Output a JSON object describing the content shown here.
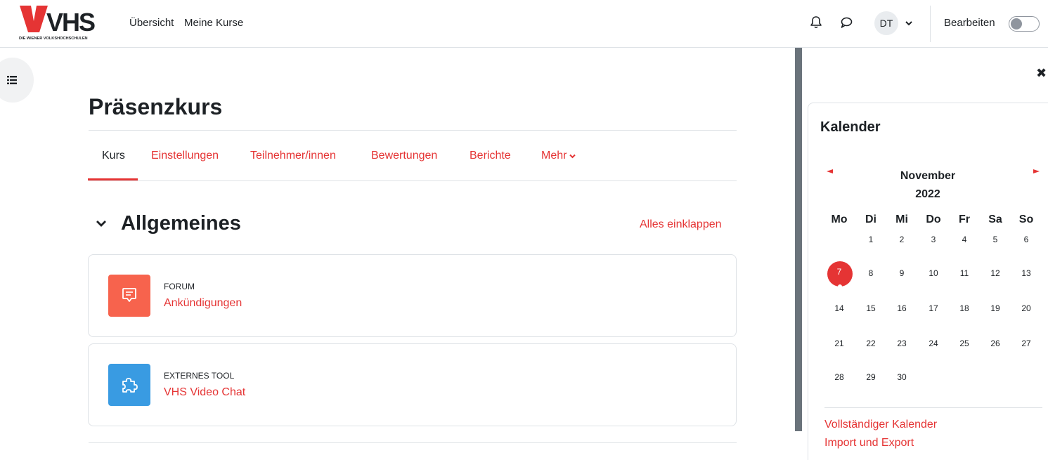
{
  "header": {
    "logo_text": "VHS",
    "logo_subtext": "DIE WIENER VOLKSHOCHSCHULEN",
    "nav": [
      "Übersicht",
      "Meine Kurse"
    ],
    "user_initials": "DT",
    "edit_mode_label": "Bearbeiten",
    "edit_mode_on": false,
    "icons": [
      "bell-icon",
      "chat-icon",
      "chevron-down-icon"
    ]
  },
  "course": {
    "title": "Präsenzkurs",
    "tabs": [
      "Kurs",
      "Einstellungen",
      "Teilnehmer/innen",
      "Bewertungen",
      "Berichte",
      "Mehr"
    ],
    "active_tab": "Kurs"
  },
  "section": {
    "title": "Allgemeines",
    "collapse_all": "Alles einklappen",
    "activities": [
      {
        "type": "FORUM",
        "name": "Ankündigungen",
        "icon": "forum-icon",
        "color": "#f7634d"
      },
      {
        "type": "EXTERNES TOOL",
        "name": "VHS Video Chat",
        "icon": "puzzle-icon",
        "color": "#399be2"
      }
    ]
  },
  "calendar": {
    "title": "Kalender",
    "month": "November",
    "year": "2022",
    "weekdays": [
      "Mo",
      "Di",
      "Mi",
      "Do",
      "Fr",
      "Sa",
      "So"
    ],
    "weeks": [
      [
        "",
        "1",
        "2",
        "3",
        "4",
        "5",
        "6"
      ],
      [
        "7",
        "8",
        "9",
        "10",
        "11",
        "12",
        "13"
      ],
      [
        "14",
        "15",
        "16",
        "17",
        "18",
        "19",
        "20"
      ],
      [
        "21",
        "22",
        "23",
        "24",
        "25",
        "26",
        "27"
      ],
      [
        "28",
        "29",
        "30",
        "",
        "",
        "",
        ""
      ]
    ],
    "today": "7",
    "links": [
      "Vollständiger Kalender",
      "Import und Export"
    ]
  },
  "colors": {
    "accent": "#e53434",
    "text": "#1d2125",
    "border": "#dee2e6"
  }
}
